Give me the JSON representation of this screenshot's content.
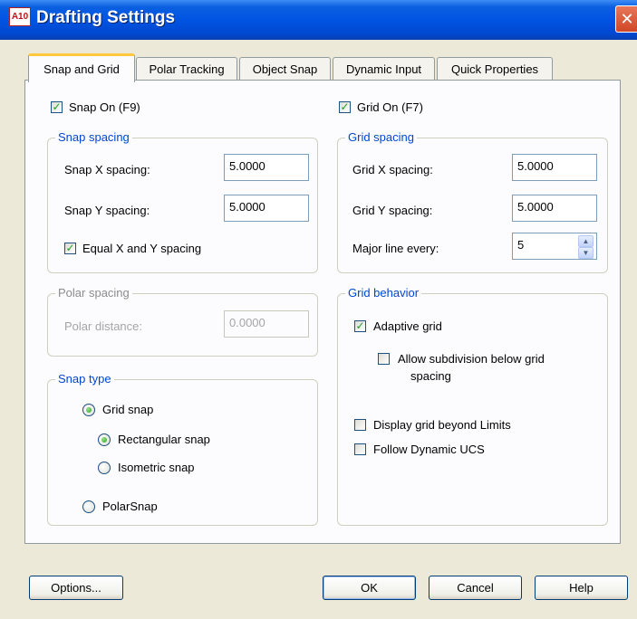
{
  "window": {
    "title": "Drafting Settings",
    "app_icon_text": "A10",
    "close_glyph": "✕"
  },
  "tabs": [
    {
      "label": "Snap and Grid"
    },
    {
      "label": "Polar Tracking"
    },
    {
      "label": "Object Snap"
    },
    {
      "label": "Dynamic Input"
    },
    {
      "label": "Quick Properties"
    }
  ],
  "snap_on": {
    "label": "Snap On (F9)",
    "checked": true
  },
  "grid_on": {
    "label": "Grid On (F7)",
    "checked": true
  },
  "snap_spacing": {
    "title": "Snap spacing",
    "x_label": "Snap X spacing:",
    "x_value": "5.0000",
    "y_label": "Snap Y spacing:",
    "y_value": "5.0000",
    "equal_label": "Equal X and Y spacing",
    "equal_checked": true
  },
  "grid_spacing": {
    "title": "Grid spacing",
    "x_label": "Grid X spacing:",
    "x_value": "5.0000",
    "y_label": "Grid Y spacing:",
    "y_value": "5.0000",
    "major_label": "Major line every:",
    "major_value": "5"
  },
  "polar_spacing": {
    "title": "Polar spacing",
    "distance_label": "Polar distance:",
    "distance_value": "0.0000"
  },
  "snap_type": {
    "title": "Snap type",
    "grid_snap": "Grid snap",
    "rectangular": "Rectangular snap",
    "isometric": "Isometric snap",
    "polarsnap": "PolarSnap",
    "selected": "grid_snap",
    "selected_sub": "rectangular"
  },
  "grid_behavior": {
    "title": "Grid behavior",
    "adaptive": "Adaptive grid",
    "adaptive_checked": true,
    "subdivision_line1": "Allow subdivision below grid",
    "subdivision_line2": "spacing",
    "subdivision_checked": false,
    "beyond_limits": "Display grid beyond Limits",
    "beyond_checked": false,
    "follow_ucs": "Follow Dynamic UCS",
    "follow_checked": false
  },
  "buttons": {
    "options": "Options...",
    "ok": "OK",
    "cancel": "Cancel",
    "help": "Help"
  },
  "check_glyph": "✓",
  "spin_up_glyph": "▲",
  "spin_down_glyph": "▼"
}
